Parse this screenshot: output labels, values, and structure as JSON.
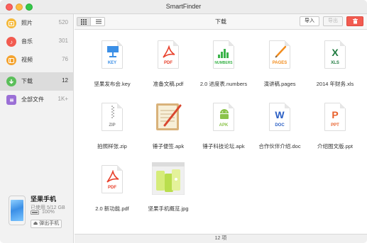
{
  "window": {
    "title": "SmartFinder"
  },
  "sidebar": {
    "items": [
      {
        "label": "照片",
        "count": "520",
        "icon": "photo-icon",
        "color": "#f5b93a"
      },
      {
        "label": "音乐",
        "count": "301",
        "icon": "music-icon",
        "color": "#f25b50"
      },
      {
        "label": "视频",
        "count": "76",
        "icon": "video-icon",
        "color": "#f4a32e"
      },
      {
        "label": "下载",
        "count": "12",
        "icon": "download-icon",
        "color": "#5bbf5a"
      },
      {
        "label": "全部文件",
        "count": "1K+",
        "icon": "all-files-icon",
        "color": "#9b6fd6"
      }
    ],
    "device": {
      "name": "坚果手机",
      "used": "已使用 5/12 GB",
      "battery": "100%",
      "battery_level": 1.0,
      "eject_label": "弹出手机"
    }
  },
  "toolbar": {
    "title": "下载",
    "import_label": "导入",
    "export_label": "导出"
  },
  "files": [
    {
      "name": "坚果发布会.key",
      "type": "KEY",
      "color": "#3b8fe6"
    },
    {
      "name": "准备文稿.pdf",
      "type": "PDF",
      "color": "#e8412c"
    },
    {
      "name": "2.0 进度表.numbers",
      "type": "NUMBERS",
      "color": "#3bb34a"
    },
    {
      "name": "演讲稿.pages",
      "type": "PAGES",
      "color": "#f28c1c"
    },
    {
      "name": "2014 年财务.xls",
      "type": "XLS",
      "color": "#1f7a3f"
    },
    {
      "name": "拍照样张.zip",
      "type": "ZIP",
      "color": "#888888"
    },
    {
      "name": "锤子便签.apk",
      "type": "APK",
      "color": "#c9985a"
    },
    {
      "name": "锤子科技论坛.apk",
      "type": "APK",
      "color": "#8bc34a"
    },
    {
      "name": "合作伙伴介绍.doc",
      "type": "DOC",
      "color": "#2b5fc4"
    },
    {
      "name": "介绍图文版.ppt",
      "type": "PPT",
      "color": "#e8612c"
    },
    {
      "name": "2.0 新功能.pdf",
      "type": "PDF",
      "color": "#e8412c"
    },
    {
      "name": "坚果手机概览.jpg",
      "type": "JPG",
      "color": "#8bc34a"
    }
  ],
  "status": {
    "count_text": "12 项"
  }
}
